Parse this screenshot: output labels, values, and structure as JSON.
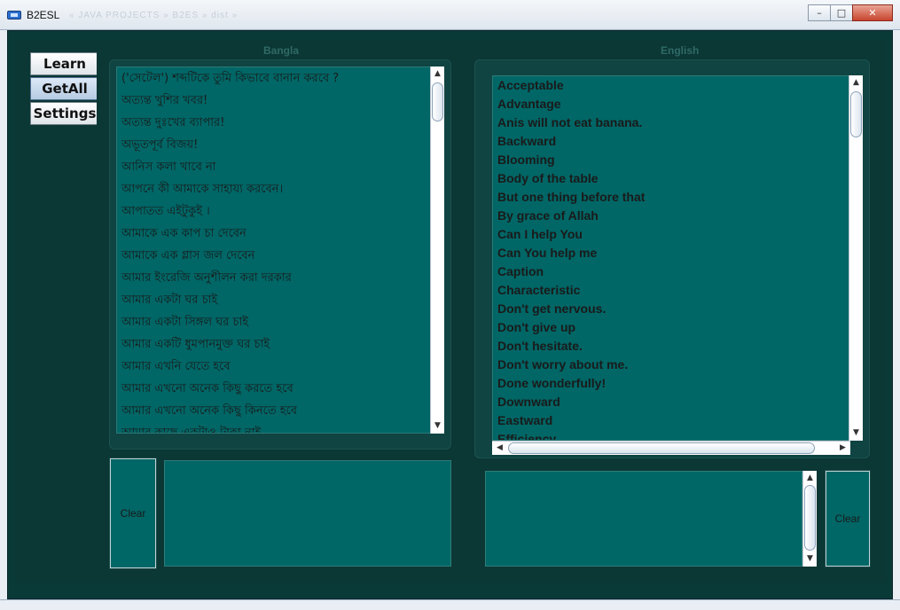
{
  "window": {
    "title": "B2ESL",
    "title_blurred": "«  JAVA PROJECTS  »  B2ES  »  dist  »",
    "controls": {
      "minimize": "–",
      "maximize": "□",
      "close": "✕"
    }
  },
  "sidebar": {
    "items": [
      {
        "label": "Learn"
      },
      {
        "label": "GetAll"
      },
      {
        "label": "Settings"
      }
    ]
  },
  "bangla": {
    "header": "Bangla",
    "items": [
      "('সেটেল') শব্দটিকে তুমি কিভাবে বানান করবে ?",
      "অত্যন্ত খুশির খবর!",
      "অত্যন্ত দুঃখের ব্যাপার!",
      "অভূতপূর্ব বিজয়!",
      "আনিস কলা খাবে না",
      "আপনে কী আমাকে সাহায্য করবেন।",
      "আপাতত এইটুকুই ।",
      "আমাকে এক কাপ চা দেবেন",
      "আমাকে এক গ্লাস জল দেবেন",
      "আমার ইংরেজি অনুশীলন করা দরকার",
      "আমার একটা ঘর চাই",
      "আমার একটা সিঙ্গল ঘর চাই",
      "আমার একটি ধুমপানমুক্ত ঘর চাই",
      "আমার এখনি যেতে হবে",
      "আমার এখনো অনেক কিছু করতে হবে",
      "আমার এখনো অনেক কিছু কিনতে হবে",
      "আমার কাছে একটাও টাকা নাই"
    ],
    "clear_label": "Clear",
    "input_value": ""
  },
  "english": {
    "header": "English",
    "items": [
      "Acceptable",
      "Advantage",
      "Anis will not eat banana.",
      "Backward",
      "Blooming",
      "Body of the table",
      "But one thing before that",
      "By grace of Allah",
      "Can I help You",
      "Can You help me",
      "Caption",
      "Characteristic",
      "Don't get nervous.",
      "Don't give up",
      "Don't hesitate.",
      "Don't worry about me.",
      "Done wonderfully!",
      "Downward",
      "Eastward",
      "Efficiency"
    ],
    "clear_label": "Clear",
    "input_value": ""
  },
  "icons": {
    "scroll_up": "▲",
    "scroll_down": "▼",
    "scroll_left": "◀",
    "scroll_right": "▶"
  },
  "colors": {
    "background": "#0b3735",
    "list_bg": "#006666",
    "header_text": "#2f6a66"
  }
}
